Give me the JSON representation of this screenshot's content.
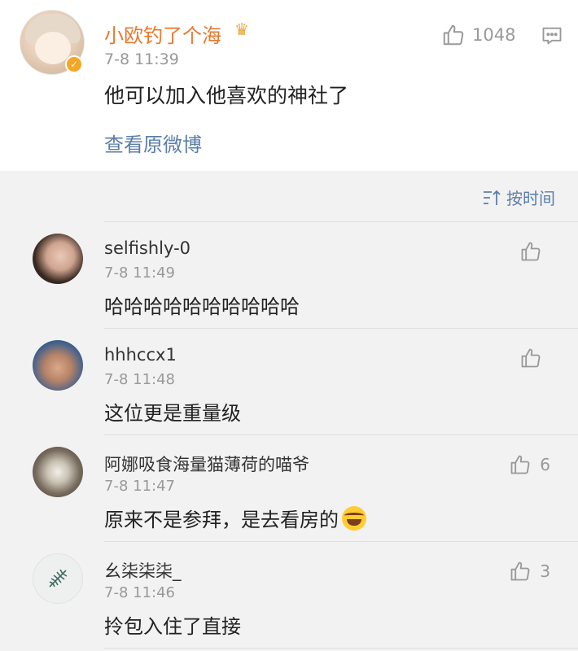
{
  "original_comment": {
    "username": "小欧钓了个海",
    "time": "7-8 11:39",
    "text": "他可以加入他喜欢的神社了",
    "like_count": "1048",
    "view_original": "查看原微博",
    "username_color": "#e8772e",
    "badge_icon": "crown-icon",
    "verified_icon": "verified-badge-icon"
  },
  "sort": {
    "label": "按时间",
    "icon": "sort-icon"
  },
  "replies": [
    {
      "username": "selfishly-0",
      "time": "7-8 11:49",
      "text": "哈哈哈哈哈哈哈哈哈哈",
      "like_count": ""
    },
    {
      "username": "hhhccx1",
      "time": "7-8 11:48",
      "text": "这位更是重量级",
      "like_count": ""
    },
    {
      "username": "阿娜吸食海量猫薄荷的喵爷",
      "time": "7-8 11:47",
      "text": "原来不是参拜，是去看房的",
      "like_count": "6",
      "emoji": "laughing-tears-emoji"
    },
    {
      "username": "幺柒柒柒_",
      "time": "7-8 11:46",
      "text": "拎包入住了直接",
      "like_count": "3"
    }
  ],
  "colors": {
    "link": "#5b7ea8",
    "meta": "#999999",
    "background": "#f2f2f2"
  }
}
